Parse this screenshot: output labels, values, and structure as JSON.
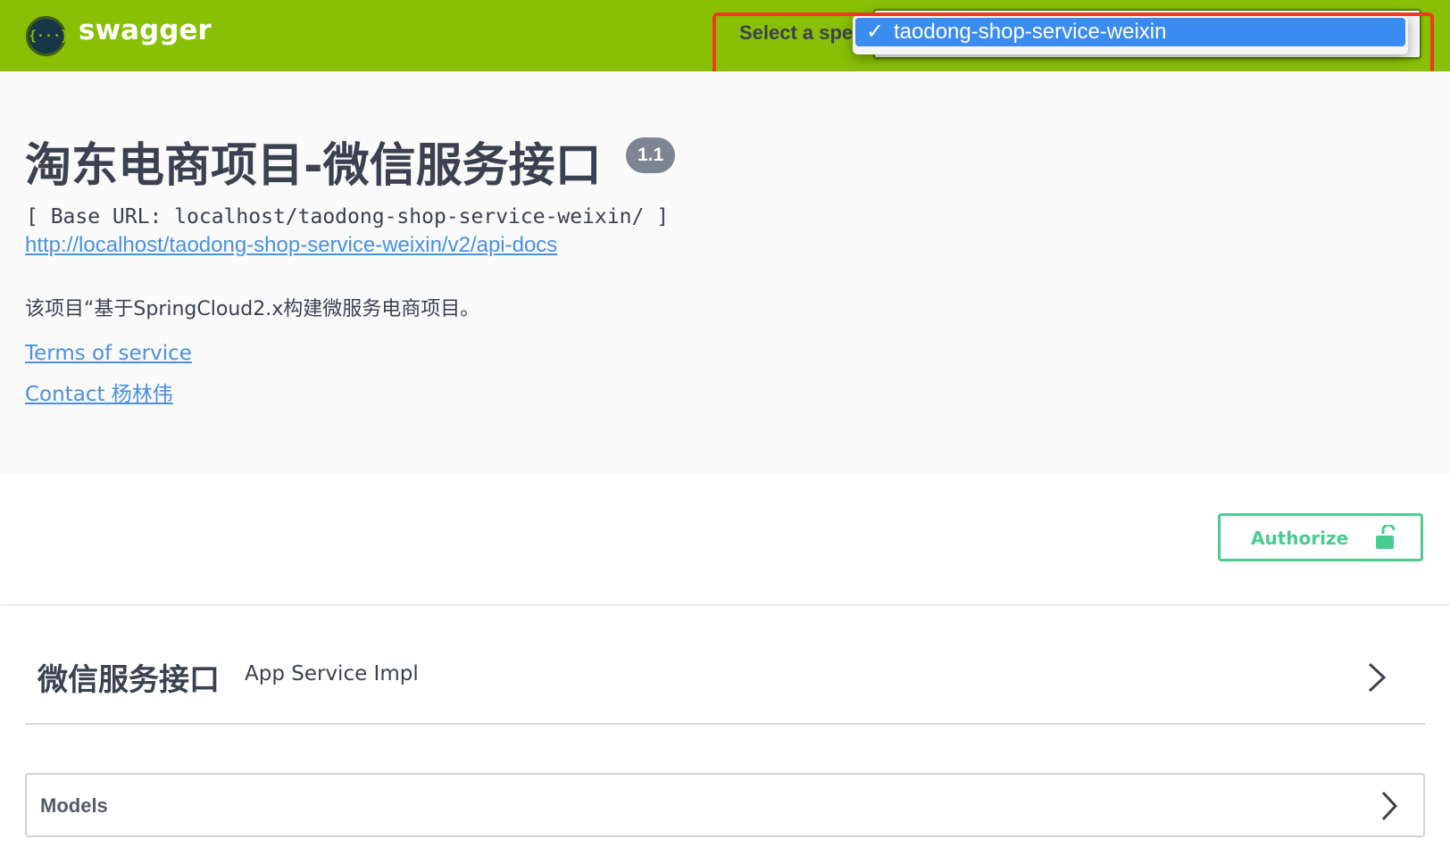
{
  "topbar": {
    "logo_icon": "{···}",
    "logo_text": "swagger",
    "spec_label": "Select a spec",
    "spec_selected": "taodong-shop-service-weixin",
    "dropdown_options": [
      {
        "check": "✓",
        "label": "taodong-shop-service-weixin"
      }
    ],
    "background_color": "#89bf04"
  },
  "info": {
    "title": "淘东电商项目-微信服务接口",
    "version": "1.1",
    "base_url": "[ Base URL: localhost/taodong-shop-service-weixin/ ]",
    "api_docs_link": "http://localhost/taodong-shop-service-weixin/v2/api-docs",
    "description": "该项目“基于SpringCloud2.x构建微服务电商项目。",
    "terms_link": "Terms of service",
    "contact_link": "Contact 杨林伟"
  },
  "authorize": {
    "label": "Authorize",
    "icon": "lock-icon",
    "color": "#49cc90"
  },
  "operations": {
    "tags": [
      {
        "name": "微信服务接口",
        "description": "App Service Impl"
      }
    ]
  },
  "models": {
    "title": "Models"
  },
  "annotation": {
    "highlight_color": "#ee3a22"
  }
}
